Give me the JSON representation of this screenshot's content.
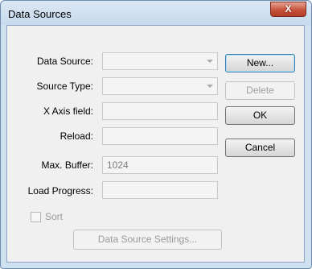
{
  "window": {
    "title": "Data Sources",
    "close_label": "X"
  },
  "form": {
    "data_source": {
      "label": "Data Source:",
      "value": ""
    },
    "source_type": {
      "label": "Source Type:",
      "value": ""
    },
    "x_axis_field": {
      "label": "X Axis field:",
      "value": ""
    },
    "reload": {
      "label": "Reload:",
      "value": ""
    },
    "max_buffer": {
      "label": "Max. Buffer:",
      "value": "1024"
    },
    "load_progress": {
      "label": "Load Progress:",
      "value": ""
    },
    "sort": {
      "label": "Sort",
      "checked": false
    },
    "settings_button_label": "Data Source Settings..."
  },
  "buttons": {
    "new": "New...",
    "delete": "Delete",
    "ok": "OK",
    "cancel": "Cancel"
  },
  "colors": {
    "close_button": "#c7533b",
    "title_bar": "#c6d9ee",
    "default_button_border": "#3c7fb1"
  }
}
